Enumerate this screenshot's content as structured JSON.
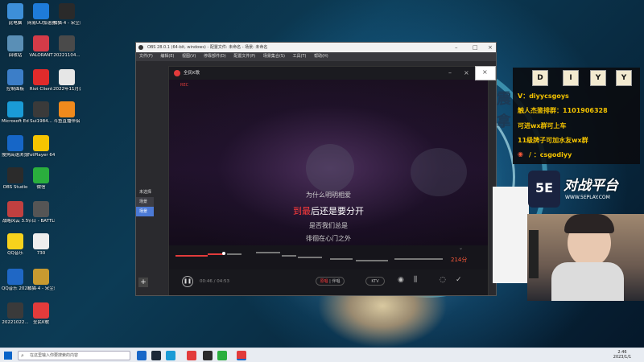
{
  "desktop": {
    "icons": [
      {
        "label": "此电脑",
        "color": "#3d8fd8"
      },
      {
        "label": "网易UU加速器",
        "color": "#1e7bd9"
      },
      {
        "label": "橘猫·4 - 宋尘蓬博 (2)",
        "color": "#2a2a2a"
      },
      {
        "label": "回收站",
        "color": "#5a8fb6"
      },
      {
        "label": "VALORANT",
        "color": "#d43b48"
      },
      {
        "label": "20221104...",
        "color": "#4a4a4a"
      },
      {
        "label": "控制面板",
        "color": "#3c7ec8"
      },
      {
        "label": "Riot Client",
        "color": "#e02b2b"
      },
      {
        "label": "2022年11月会员日直播...",
        "color": "#e6e6e6"
      },
      {
        "label": "Microsoft Edge",
        "color": "#1a9bd6"
      },
      {
        "label": "Sui1984...",
        "color": "#3a3a3a"
      },
      {
        "label": "斗鱼直播伴侣",
        "color": "#f08a1c"
      },
      {
        "label": "搜狗高速浏览器",
        "color": "#1666c7"
      },
      {
        "label": "FotPlayer 64 bit",
        "color": "#f5c400"
      },
      {
        "label": "OBS Studio",
        "color": "#2b2b2b"
      },
      {
        "label": "微信",
        "color": "#2aae3d"
      },
      {
        "label": "战略风云 3.5",
        "color": "#c04040"
      },
      {
        "label": "节日 - BATTLEGR...",
        "color": "#555"
      },
      {
        "label": "QQ音乐",
        "color": "#f7d21c"
      },
      {
        "label": "730",
        "color": "#eeeeee"
      },
      {
        "label": "QQ音乐 20221021...",
        "color": "#1f67c5"
      },
      {
        "label": "橘猫·4 - 宋尘蓬博 (2(1)",
        "color": "#c89a30"
      },
      {
        "label": "20221022...",
        "color": "#3a3a3a"
      },
      {
        "label": "全民K歌",
        "color": "#e23b3b"
      }
    ]
  },
  "obs": {
    "title": "OBS 28.0.1 (64-bit, windows) - 配置文件: 未命名 - 场景: 未命名",
    "menu": [
      "文件(F)",
      "编辑(E)",
      "视图(V)",
      "停靠部件(D)",
      "配置文件(P)",
      "场景集合(S)",
      "工具(T)",
      "帮助(H)"
    ],
    "side_items": [
      "未选择",
      "场景",
      "场景"
    ],
    "add_button": "+"
  },
  "karaoke": {
    "title": "全民K歌",
    "rec": "REC",
    "lyrics": {
      "line1": "为什么明明相爱",
      "line2_sung": "到最",
      "line2_rest": "后还是要分开",
      "line3": "是否我们总是",
      "line4": "徘徊在心门之外"
    },
    "score": "214分",
    "time": "00:46 / 04:53",
    "original_label": "原唱",
    "accompany_label": "伴唱",
    "ktv_label": "KTV"
  },
  "overlay": {
    "letters": [
      "D",
      "I",
      "Y",
      "Y"
    ],
    "lines": [
      "V：diyycsgoys",
      "触人杰鉴排群：1101906328",
      "可进wx群可上车",
      "11级牌子可加水友wx群",
      "/ ：csgodiyy"
    ],
    "brand": "对战平台",
    "brand_url": "WWW.5EPLAY.COM",
    "logo_text": "5E",
    "bg_chars": "震 拿"
  },
  "taskbar": {
    "search_placeholder": "在这里输入你要搜索的内容",
    "time": "2:46",
    "date": "2023/1/1"
  },
  "colors": {
    "accent_red": "#ff3b3b",
    "overlay_yellow": "#f5c400"
  }
}
